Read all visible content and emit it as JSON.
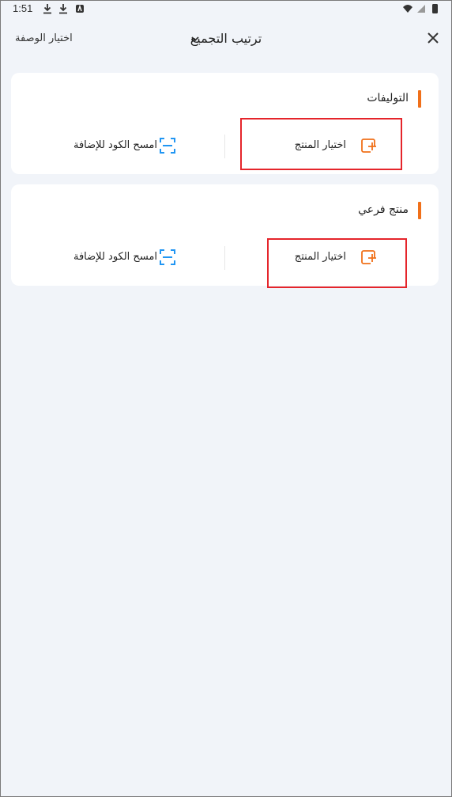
{
  "status_bar": {
    "time": "1:51",
    "icons": [
      "download-icon",
      "download-icon",
      "app-icon",
      "wifi-icon",
      "signal-icon",
      "battery-icon"
    ]
  },
  "header": {
    "select_recipe_label": "اختيار الوصفة",
    "title": "ترتيب التجميع",
    "chevron_icon": "chevron-down-icon",
    "close_icon": "close-icon"
  },
  "colors": {
    "accent": "#f0701a",
    "scan_blue": "#2196f3",
    "highlight": "#e5252b",
    "background": "#f1f4f9"
  },
  "sections": [
    {
      "title": "التوليفات",
      "select_product_label": "اختيار المنتج",
      "select_icon": "add-product-icon",
      "scan_label": "امسح الكود للإضافة",
      "scan_icon": "scan-icon"
    },
    {
      "title": "منتج فرعي",
      "select_product_label": "اختيار المنتج",
      "select_icon": "add-product-icon",
      "scan_label": "امسح الكود للإضافة",
      "scan_icon": "scan-icon"
    }
  ]
}
